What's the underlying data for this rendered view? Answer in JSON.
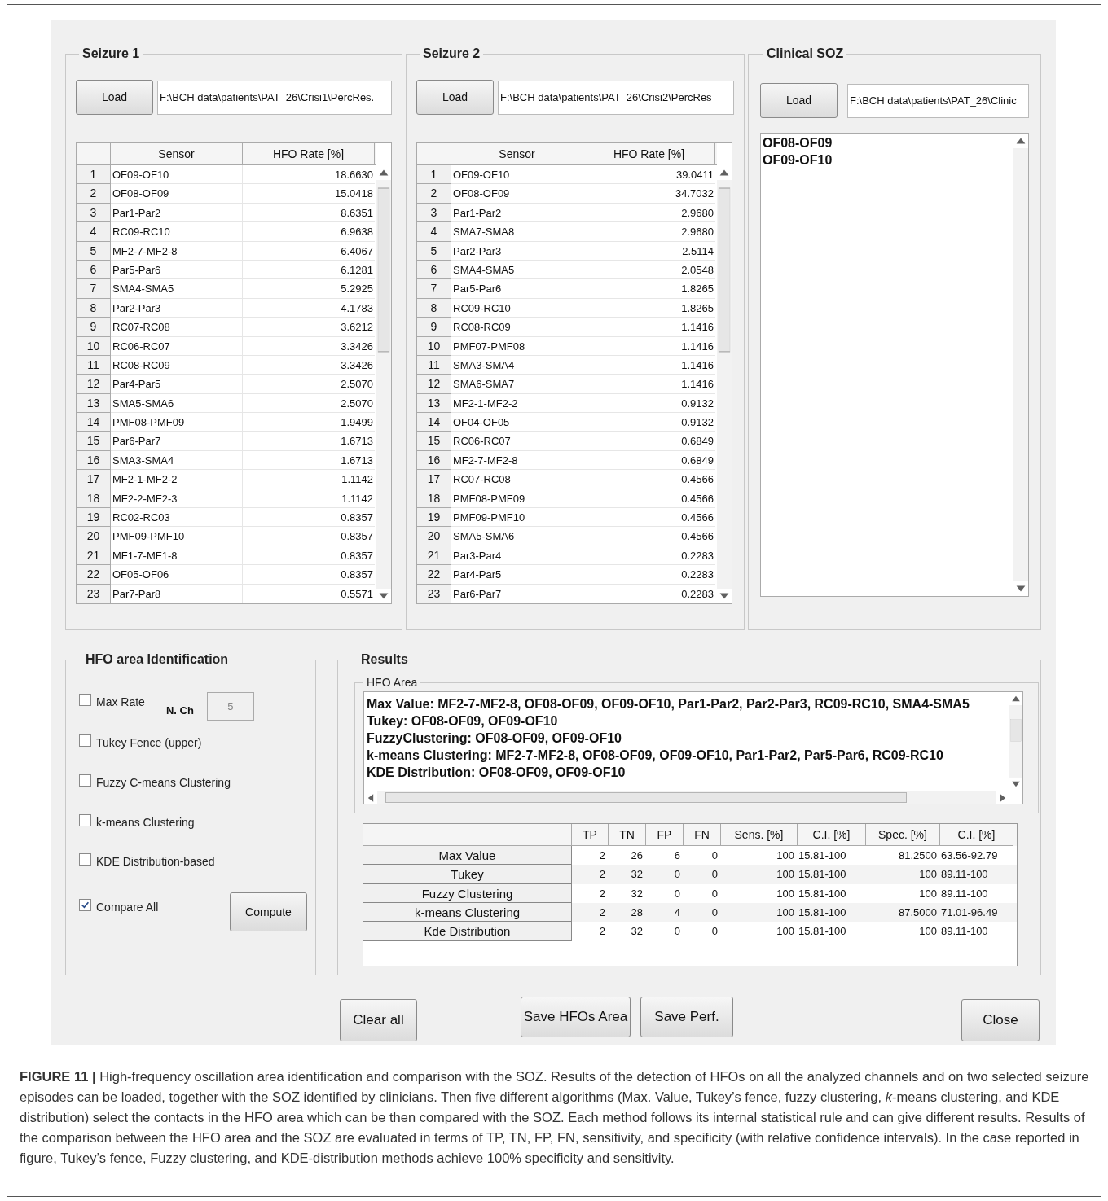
{
  "seizures": [
    {
      "title": "Seizure 1",
      "load_button": "Load",
      "path": "F:\\BCH data\\patients\\PAT_26\\Crisi1\\PercRes.",
      "columns": [
        "Sensor",
        "HFO Rate [%]"
      ],
      "rows": [
        [
          "1",
          "OF09-OF10",
          "18.6630"
        ],
        [
          "2",
          "OF08-OF09",
          "15.0418"
        ],
        [
          "3",
          "Par1-Par2",
          "8.6351"
        ],
        [
          "4",
          "RC09-RC10",
          "6.9638"
        ],
        [
          "5",
          "MF2-7-MF2-8",
          "6.4067"
        ],
        [
          "6",
          "Par5-Par6",
          "6.1281"
        ],
        [
          "7",
          "SMA4-SMA5",
          "5.2925"
        ],
        [
          "8",
          "Par2-Par3",
          "4.1783"
        ],
        [
          "9",
          "RC07-RC08",
          "3.6212"
        ],
        [
          "10",
          "RC06-RC07",
          "3.3426"
        ],
        [
          "11",
          "RC08-RC09",
          "3.3426"
        ],
        [
          "12",
          "Par4-Par5",
          "2.5070"
        ],
        [
          "13",
          "SMA5-SMA6",
          "2.5070"
        ],
        [
          "14",
          "PMF08-PMF09",
          "1.9499"
        ],
        [
          "15",
          "Par6-Par7",
          "1.6713"
        ],
        [
          "16",
          "SMA3-SMA4",
          "1.6713"
        ],
        [
          "17",
          "MF2-1-MF2-2",
          "1.1142"
        ],
        [
          "18",
          "MF2-2-MF2-3",
          "1.1142"
        ],
        [
          "19",
          "RC02-RC03",
          "0.8357"
        ],
        [
          "20",
          "PMF09-PMF10",
          "0.8357"
        ],
        [
          "21",
          "MF1-7-MF1-8",
          "0.8357"
        ],
        [
          "22",
          "OF05-OF06",
          "0.8357"
        ],
        [
          "23",
          "Par7-Par8",
          "0.5571"
        ]
      ]
    },
    {
      "title": "Seizure 2",
      "load_button": "Load",
      "path": "F:\\BCH data\\patients\\PAT_26\\Crisi2\\PercRes",
      "columns": [
        "Sensor",
        "HFO Rate [%]"
      ],
      "rows": [
        [
          "1",
          "OF09-OF10",
          "39.0411"
        ],
        [
          "2",
          "OF08-OF09",
          "34.7032"
        ],
        [
          "3",
          "Par1-Par2",
          "2.9680"
        ],
        [
          "4",
          "SMA7-SMA8",
          "2.9680"
        ],
        [
          "5",
          "Par2-Par3",
          "2.5114"
        ],
        [
          "6",
          "SMA4-SMA5",
          "2.0548"
        ],
        [
          "7",
          "Par5-Par6",
          "1.8265"
        ],
        [
          "8",
          "RC09-RC10",
          "1.8265"
        ],
        [
          "9",
          "RC08-RC09",
          "1.1416"
        ],
        [
          "10",
          "PMF07-PMF08",
          "1.1416"
        ],
        [
          "11",
          "SMA3-SMA4",
          "1.1416"
        ],
        [
          "12",
          "SMA6-SMA7",
          "1.1416"
        ],
        [
          "13",
          "MF2-1-MF2-2",
          "0.9132"
        ],
        [
          "14",
          "OF04-OF05",
          "0.9132"
        ],
        [
          "15",
          "RC06-RC07",
          "0.6849"
        ],
        [
          "16",
          "MF2-7-MF2-8",
          "0.6849"
        ],
        [
          "17",
          "RC07-RC08",
          "0.4566"
        ],
        [
          "18",
          "PMF08-PMF09",
          "0.4566"
        ],
        [
          "19",
          "PMF09-PMF10",
          "0.4566"
        ],
        [
          "20",
          "SMA5-SMA6",
          "0.4566"
        ],
        [
          "21",
          "Par3-Par4",
          "0.2283"
        ],
        [
          "22",
          "Par4-Par5",
          "0.2283"
        ],
        [
          "23",
          "Par6-Par7",
          "0.2283"
        ]
      ]
    }
  ],
  "clinical_soz": {
    "title": "Clinical SOZ",
    "load_button": "Load",
    "path": "F:\\BCH data\\patients\\PAT_26\\Clinic",
    "items": [
      "OF08-OF09",
      "OF09-OF10"
    ]
  },
  "identification": {
    "title": "HFO area Identification",
    "nch_label": "N. Ch",
    "nch_value": "5",
    "methods": [
      {
        "label": "Max Rate",
        "checked": false
      },
      {
        "label": "Tukey Fence (upper)",
        "checked": false
      },
      {
        "label": "Fuzzy C-means Clustering",
        "checked": false
      },
      {
        "label": "k-means Clustering",
        "checked": false
      },
      {
        "label": "KDE Distribution-based",
        "checked": false
      },
      {
        "label": "Compare All",
        "checked": true
      }
    ],
    "compute_button": "Compute"
  },
  "results": {
    "title": "Results",
    "hfo_area_title": "HFO Area",
    "hfo_area_lines": [
      "Max Value: MF2-7-MF2-8, OF08-OF09, OF09-OF10, Par1-Par2, Par2-Par3, RC09-RC10, SMA4-SMA5",
      "Tukey: OF08-OF09, OF09-OF10",
      "FuzzyClustering: OF08-OF09, OF09-OF10",
      "k-means Clustering: MF2-7-MF2-8, OF08-OF09, OF09-OF10, Par1-Par2, Par5-Par6, RC09-RC10",
      "KDE Distribution: OF08-OF09, OF09-OF10"
    ],
    "columns": [
      "TP",
      "TN",
      "FP",
      "FN",
      "Sens. [%]",
      "C.I. [%]",
      "Spec. [%]",
      "C.I. [%]"
    ],
    "rows": [
      {
        "label": "Max Value",
        "cells": [
          "2",
          "26",
          "6",
          "0",
          "100",
          "15.81-100",
          "81.2500",
          "63.56-92.79"
        ]
      },
      {
        "label": "Tukey",
        "cells": [
          "2",
          "32",
          "0",
          "0",
          "100",
          "15.81-100",
          "100",
          "89.11-100"
        ]
      },
      {
        "label": "Fuzzy Clustering",
        "cells": [
          "2",
          "32",
          "0",
          "0",
          "100",
          "15.81-100",
          "100",
          "89.11-100"
        ]
      },
      {
        "label": "k-means Clustering",
        "cells": [
          "2",
          "28",
          "4",
          "0",
          "100",
          "15.81-100",
          "87.5000",
          "71.01-96.49"
        ]
      },
      {
        "label": "Kde Distribution",
        "cells": [
          "2",
          "32",
          "0",
          "0",
          "100",
          "15.81-100",
          "100",
          "89.11-100"
        ]
      }
    ]
  },
  "buttons": [
    "Clear all",
    "Save HFOs Area",
    "Save Perf.",
    "Close"
  ],
  "caption": "**FIGURE 11 |** High-frequency oscillation area identification and comparison with the SOZ. Results of the detection of HFOs on all the analyzed channels and on two selected seizure episodes can be loaded, together with the SOZ identified by clinicians. Then five different algorithms (Max. Value, Tukey’s fence, fuzzy clustering, *k*-means clustering, and KDE distribution) select the contacts in the HFO area which can be then compared with the SOZ. Each method follows its internal statistical rule and can give different results. Results of the comparison between the HFO area and the SOZ are evaluated in terms of TP, TN, FP, FN, sensitivity, and specificity (with relative confidence intervals). In the case reported in figure, Tukey’s fence, Fuzzy clustering, and KDE-distribution methods achieve 100% specificity and sensitivity."
}
